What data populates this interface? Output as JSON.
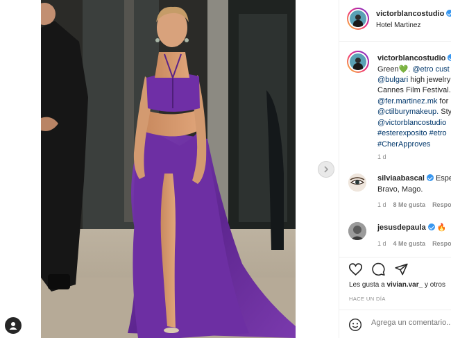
{
  "post": {
    "author": "victorblancostudio",
    "location": "Hotel Martinez"
  },
  "caption": {
    "author": "victorblancostudio",
    "lines": [
      {
        "text": "Green💚. ",
        "mention": "@etro cust"
      },
      {
        "text": "",
        "mention": "@bulgari",
        "rest": " high jewelry"
      },
      {
        "text": "Cannes Film Festival.",
        "mention": ""
      },
      {
        "text": "",
        "mention": "@fer.martinez.mk",
        "rest": " for"
      },
      {
        "text": "",
        "mention": "@ctilburymakeup.",
        "rest": " Sty"
      },
      {
        "text": "",
        "mention": "@victorblancostudio"
      },
      {
        "text": "",
        "mention": "#esterexposito #etro"
      },
      {
        "text": "",
        "mention": "#CherApproves"
      }
    ],
    "age": "1 d"
  },
  "comments": [
    {
      "author": "silviaabascal",
      "text_inline": "Espec",
      "text_next": "Bravo, Mago.",
      "age": "1 d",
      "likes": "8 Me gusta",
      "reply": "Respo"
    },
    {
      "author": "jesusdepaula",
      "text_inline": "🔥",
      "age": "1 d",
      "likes": "4 Me gusta",
      "reply": "Respo"
    }
  ],
  "likes": {
    "prefix": "Les gusta a ",
    "user": "vivian.var_",
    "suffix": " y otros"
  },
  "time_ago": "Hace un día",
  "composer": {
    "placeholder": "Agrega un comentario..."
  },
  "icons": {
    "like": "heart-icon",
    "comment": "comment-icon",
    "share": "send-icon",
    "emoji": "emoji-icon",
    "next": "chevron-right-icon",
    "profile": "user-icon"
  },
  "colors": {
    "dress": "#6a2f9e",
    "verified": "#3897f0",
    "link": "#00376b",
    "muted": "#8e8e8e"
  }
}
